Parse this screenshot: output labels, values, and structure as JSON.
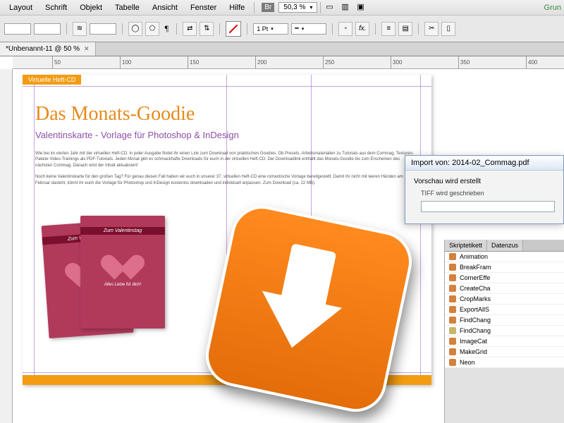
{
  "menu": {
    "layout": "Layout",
    "schrift": "Schrift",
    "objekt": "Objekt",
    "tabelle": "Tabelle",
    "ansicht": "Ansicht",
    "fenster": "Fenster",
    "hilfe": "Hilfe",
    "br": "Br",
    "zoom": "50,3 %",
    "grun": "Grun"
  },
  "opt": {
    "stroke_weight": "1 Pt"
  },
  "doctab": {
    "title": "*Unbenannt-11 @ 50 %"
  },
  "ruler": {
    "t50": "50",
    "t100": "100",
    "t150": "150",
    "t200": "200",
    "t250": "250",
    "t300": "300",
    "t350": "350",
    "t400": "400"
  },
  "page": {
    "tag": "Virtuelle Heft-CD",
    "headline": "Das Monats-Goodie",
    "subhead": "Valentinskarte - Vorlage für Photoshop & InDesign",
    "para1": "Wie bei im vierten Jahr mit der virtuellen Heft-CD. In jeder Ausgabe findet ihr einen Link zum Download von praktischen Goodies. Ob Presets, Arbeitsmaterialien zu Tutorials aus dem Commag, Texturen-Pakete Video-Trainings als PDF-Tutorials. Jeden Monat gibt es schmackhafte Downloads für euch in der virtuellen Heft-CD. Der Downloadlink enthällt das Monats-Goodie bis zum Erscheinen des nächsten Commag. Danach wird der Inhalt aktualisiert!",
    "para2": "Noch keine Valentinskarte für den großen Tag? Für genau diesen Fall haben wir euch in unserer 37. virtuellen Heft-CD eine romantische Vorlage bereitgestellt. Damit ihr nicht mit leeren Händen am 14. Februar dasteht, könnt ihr euch die Vorlage für Photoshop und InDesign kostenlos downloaden und individuell anpassen. Zum Download (ca. 22 MB).",
    "card_ribbon1": "Zum Valentin…",
    "card_ribbon2": "Zum Valentinstag",
    "card_foot": "Alles Liebe für dich!"
  },
  "dialog": {
    "title": "Import von: 2014-02_Commag.pdf",
    "line1": "Vorschau wird erstellt",
    "line2": "TIFF wird geschrieben"
  },
  "panel": {
    "tab1": "Skriptetikett",
    "tab2": "Datenzus",
    "scripts": [
      "Animation",
      "BreakFram",
      "CornerEffe",
      "CreateCha",
      "CropMarks",
      "ExportAllS",
      "FindChang",
      "FindChang",
      "ImageCat",
      "MakeGrid",
      "Neon"
    ]
  }
}
